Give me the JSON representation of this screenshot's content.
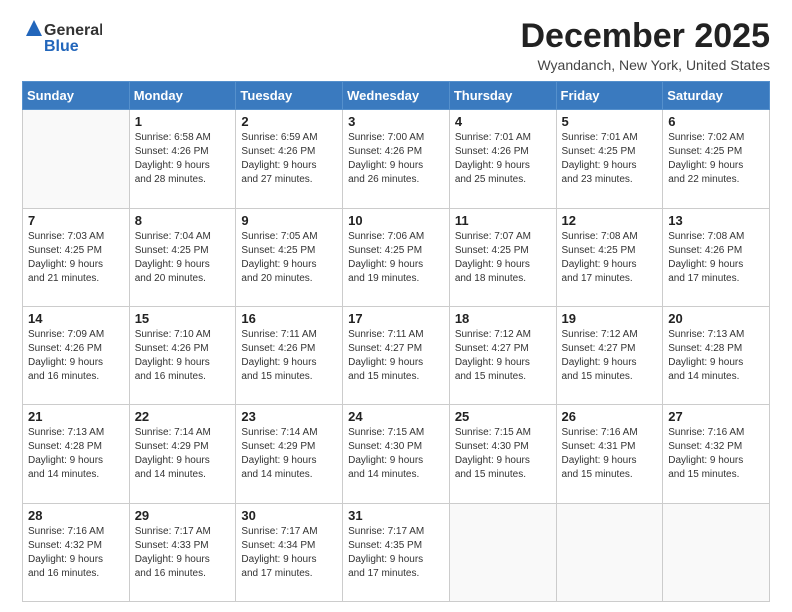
{
  "header": {
    "logo_general": "General",
    "logo_blue": "Blue",
    "title": "December 2025",
    "location": "Wyandanch, New York, United States"
  },
  "days_of_week": [
    "Sunday",
    "Monday",
    "Tuesday",
    "Wednesday",
    "Thursday",
    "Friday",
    "Saturday"
  ],
  "weeks": [
    [
      {
        "day": "",
        "info": ""
      },
      {
        "day": "1",
        "info": "Sunrise: 6:58 AM\nSunset: 4:26 PM\nDaylight: 9 hours\nand 28 minutes."
      },
      {
        "day": "2",
        "info": "Sunrise: 6:59 AM\nSunset: 4:26 PM\nDaylight: 9 hours\nand 27 minutes."
      },
      {
        "day": "3",
        "info": "Sunrise: 7:00 AM\nSunset: 4:26 PM\nDaylight: 9 hours\nand 26 minutes."
      },
      {
        "day": "4",
        "info": "Sunrise: 7:01 AM\nSunset: 4:26 PM\nDaylight: 9 hours\nand 25 minutes."
      },
      {
        "day": "5",
        "info": "Sunrise: 7:01 AM\nSunset: 4:25 PM\nDaylight: 9 hours\nand 23 minutes."
      },
      {
        "day": "6",
        "info": "Sunrise: 7:02 AM\nSunset: 4:25 PM\nDaylight: 9 hours\nand 22 minutes."
      }
    ],
    [
      {
        "day": "7",
        "info": "Sunrise: 7:03 AM\nSunset: 4:25 PM\nDaylight: 9 hours\nand 21 minutes."
      },
      {
        "day": "8",
        "info": "Sunrise: 7:04 AM\nSunset: 4:25 PM\nDaylight: 9 hours\nand 20 minutes."
      },
      {
        "day": "9",
        "info": "Sunrise: 7:05 AM\nSunset: 4:25 PM\nDaylight: 9 hours\nand 20 minutes."
      },
      {
        "day": "10",
        "info": "Sunrise: 7:06 AM\nSunset: 4:25 PM\nDaylight: 9 hours\nand 19 minutes."
      },
      {
        "day": "11",
        "info": "Sunrise: 7:07 AM\nSunset: 4:25 PM\nDaylight: 9 hours\nand 18 minutes."
      },
      {
        "day": "12",
        "info": "Sunrise: 7:08 AM\nSunset: 4:25 PM\nDaylight: 9 hours\nand 17 minutes."
      },
      {
        "day": "13",
        "info": "Sunrise: 7:08 AM\nSunset: 4:26 PM\nDaylight: 9 hours\nand 17 minutes."
      }
    ],
    [
      {
        "day": "14",
        "info": "Sunrise: 7:09 AM\nSunset: 4:26 PM\nDaylight: 9 hours\nand 16 minutes."
      },
      {
        "day": "15",
        "info": "Sunrise: 7:10 AM\nSunset: 4:26 PM\nDaylight: 9 hours\nand 16 minutes."
      },
      {
        "day": "16",
        "info": "Sunrise: 7:11 AM\nSunset: 4:26 PM\nDaylight: 9 hours\nand 15 minutes."
      },
      {
        "day": "17",
        "info": "Sunrise: 7:11 AM\nSunset: 4:27 PM\nDaylight: 9 hours\nand 15 minutes."
      },
      {
        "day": "18",
        "info": "Sunrise: 7:12 AM\nSunset: 4:27 PM\nDaylight: 9 hours\nand 15 minutes."
      },
      {
        "day": "19",
        "info": "Sunrise: 7:12 AM\nSunset: 4:27 PM\nDaylight: 9 hours\nand 15 minutes."
      },
      {
        "day": "20",
        "info": "Sunrise: 7:13 AM\nSunset: 4:28 PM\nDaylight: 9 hours\nand 14 minutes."
      }
    ],
    [
      {
        "day": "21",
        "info": "Sunrise: 7:13 AM\nSunset: 4:28 PM\nDaylight: 9 hours\nand 14 minutes."
      },
      {
        "day": "22",
        "info": "Sunrise: 7:14 AM\nSunset: 4:29 PM\nDaylight: 9 hours\nand 14 minutes."
      },
      {
        "day": "23",
        "info": "Sunrise: 7:14 AM\nSunset: 4:29 PM\nDaylight: 9 hours\nand 14 minutes."
      },
      {
        "day": "24",
        "info": "Sunrise: 7:15 AM\nSunset: 4:30 PM\nDaylight: 9 hours\nand 14 minutes."
      },
      {
        "day": "25",
        "info": "Sunrise: 7:15 AM\nSunset: 4:30 PM\nDaylight: 9 hours\nand 15 minutes."
      },
      {
        "day": "26",
        "info": "Sunrise: 7:16 AM\nSunset: 4:31 PM\nDaylight: 9 hours\nand 15 minutes."
      },
      {
        "day": "27",
        "info": "Sunrise: 7:16 AM\nSunset: 4:32 PM\nDaylight: 9 hours\nand 15 minutes."
      }
    ],
    [
      {
        "day": "28",
        "info": "Sunrise: 7:16 AM\nSunset: 4:32 PM\nDaylight: 9 hours\nand 16 minutes."
      },
      {
        "day": "29",
        "info": "Sunrise: 7:17 AM\nSunset: 4:33 PM\nDaylight: 9 hours\nand 16 minutes."
      },
      {
        "day": "30",
        "info": "Sunrise: 7:17 AM\nSunset: 4:34 PM\nDaylight: 9 hours\nand 17 minutes."
      },
      {
        "day": "31",
        "info": "Sunrise: 7:17 AM\nSunset: 4:35 PM\nDaylight: 9 hours\nand 17 minutes."
      },
      {
        "day": "",
        "info": ""
      },
      {
        "day": "",
        "info": ""
      },
      {
        "day": "",
        "info": ""
      }
    ]
  ]
}
